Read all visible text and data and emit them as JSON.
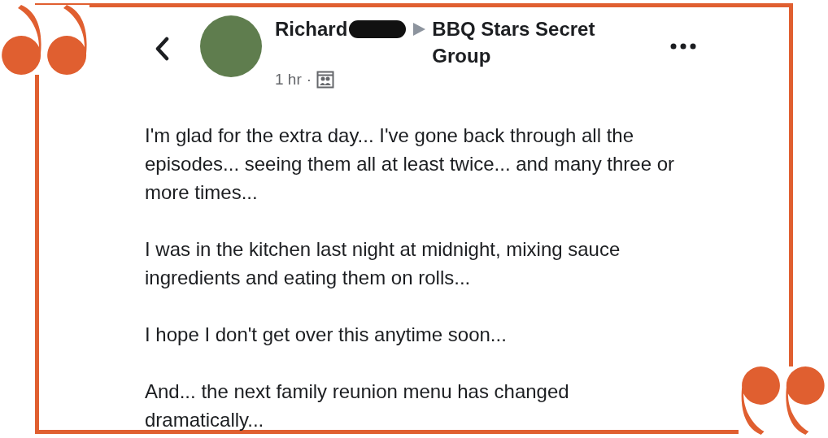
{
  "post": {
    "author": "Richard",
    "group": "BBQ Stars Secret Group",
    "time": "1 hr",
    "separator": "·",
    "paragraphs": [
      "I'm glad for the extra day... I've gone back through all the episodes... seeing them all at least twice... and many three or more times...",
      "I was in the kitchen last night at midnight, mixing sauce ingredients and eating them on rolls...",
      "I hope I don't get over this anytime soon...",
      "And... the next family reunion menu has changed dramatically..."
    ]
  }
}
